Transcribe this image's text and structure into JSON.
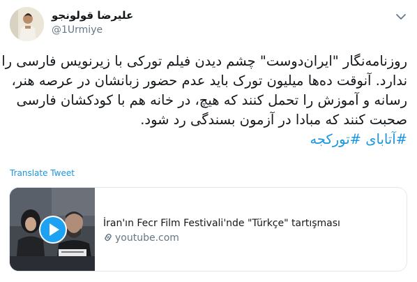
{
  "author": {
    "display_name": "علیرضا قولونجو",
    "handle": "@1Urmiye"
  },
  "menu": {
    "caret_icon": "chevron-down-icon"
  },
  "tweet": {
    "lines": [
      "روزنامه‌نگار \"ایران‌دوست\" چشم دیدن فیلم تورکی با زیرنویس فارسی را",
      "ندارد. آنوقت ده‌ها میلیون تورک باید عدم حضور زبانشان در عرصه هنر،",
      "رسانه و آموزش را تحمل کنند که هیچ، در خانه هم با کودکشان فارسی",
      "صحبت کنند که مبادا در آزمون بسندگی رد شود."
    ],
    "hashtags": [
      "#آتابای",
      "#تورکجه"
    ]
  },
  "translate_label": "Translate Tweet",
  "card": {
    "title": "İran'ın Fecr Film Festivali'nde \"Türkçe\" tartışması",
    "domain": "youtube.com",
    "link_icon": "link-icon",
    "play_icon": "play-icon",
    "thumbnail": "video-thumbnail"
  },
  "colors": {
    "link": "#1b95e0",
    "text": "#14171a",
    "secondary": "#657786",
    "border": "#e1e8ed"
  }
}
